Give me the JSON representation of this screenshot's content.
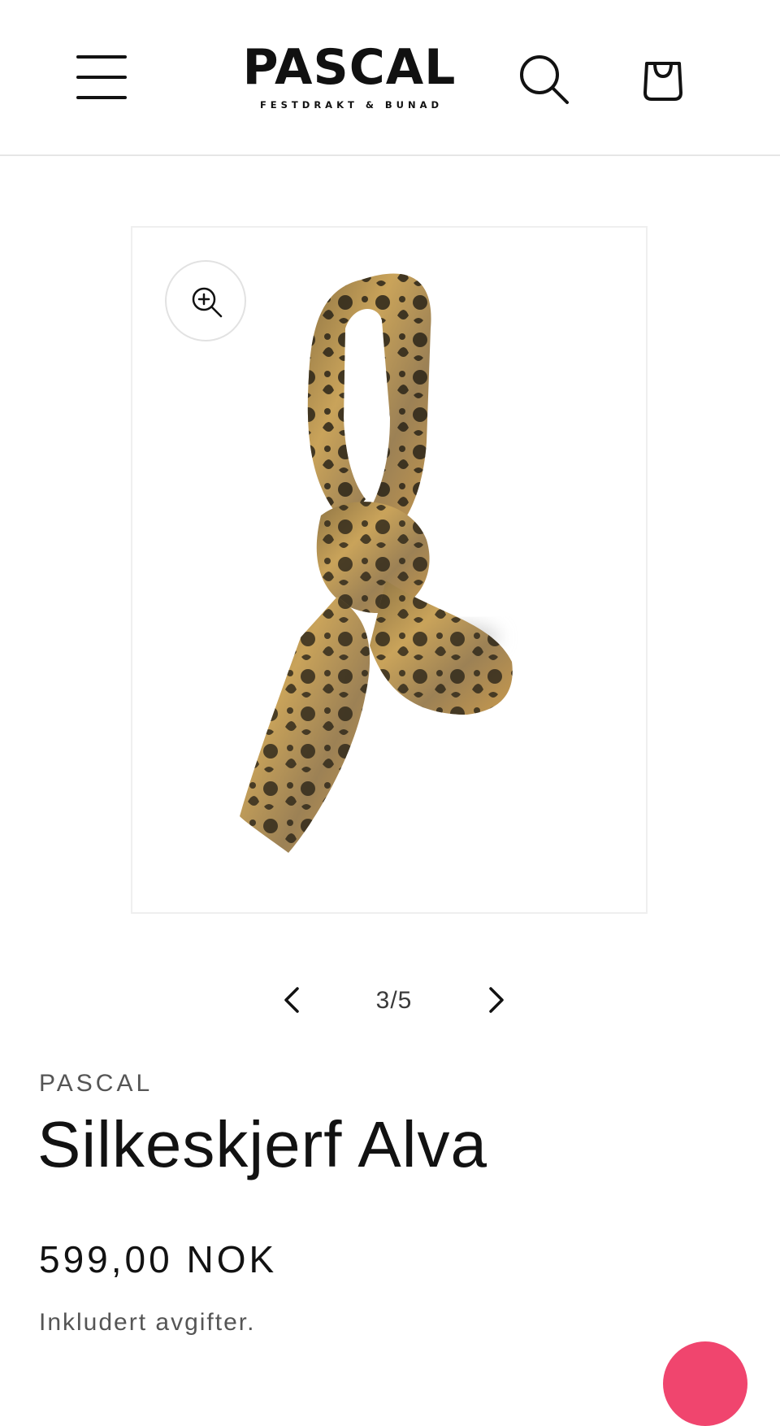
{
  "header": {
    "logo_main": "PASCAL",
    "logo_sub": "FESTDRAKT & BUNAD",
    "menu_icon": "hamburger-menu-icon",
    "search_icon": "search-icon",
    "cart_icon": "shopping-bag-icon"
  },
  "gallery": {
    "image_alt": "Silkeskjerf Alva",
    "zoom_icon": "zoom-in-icon",
    "current": "3/5",
    "prev_icon": "chevron-left-icon",
    "next_icon": "chevron-right-icon"
  },
  "product": {
    "vendor": "PASCAL",
    "title": "Silkeskjerf Alva",
    "price": "599,00 NOK",
    "tax_note": "Inkludert avgifter."
  },
  "colors": {
    "text": "#121212",
    "muted": "#555555",
    "border": "#e6e6e6",
    "scarf_gold": "#c9a35a",
    "scarf_dark": "#2a2418",
    "chat_accent": "#f0456e"
  }
}
